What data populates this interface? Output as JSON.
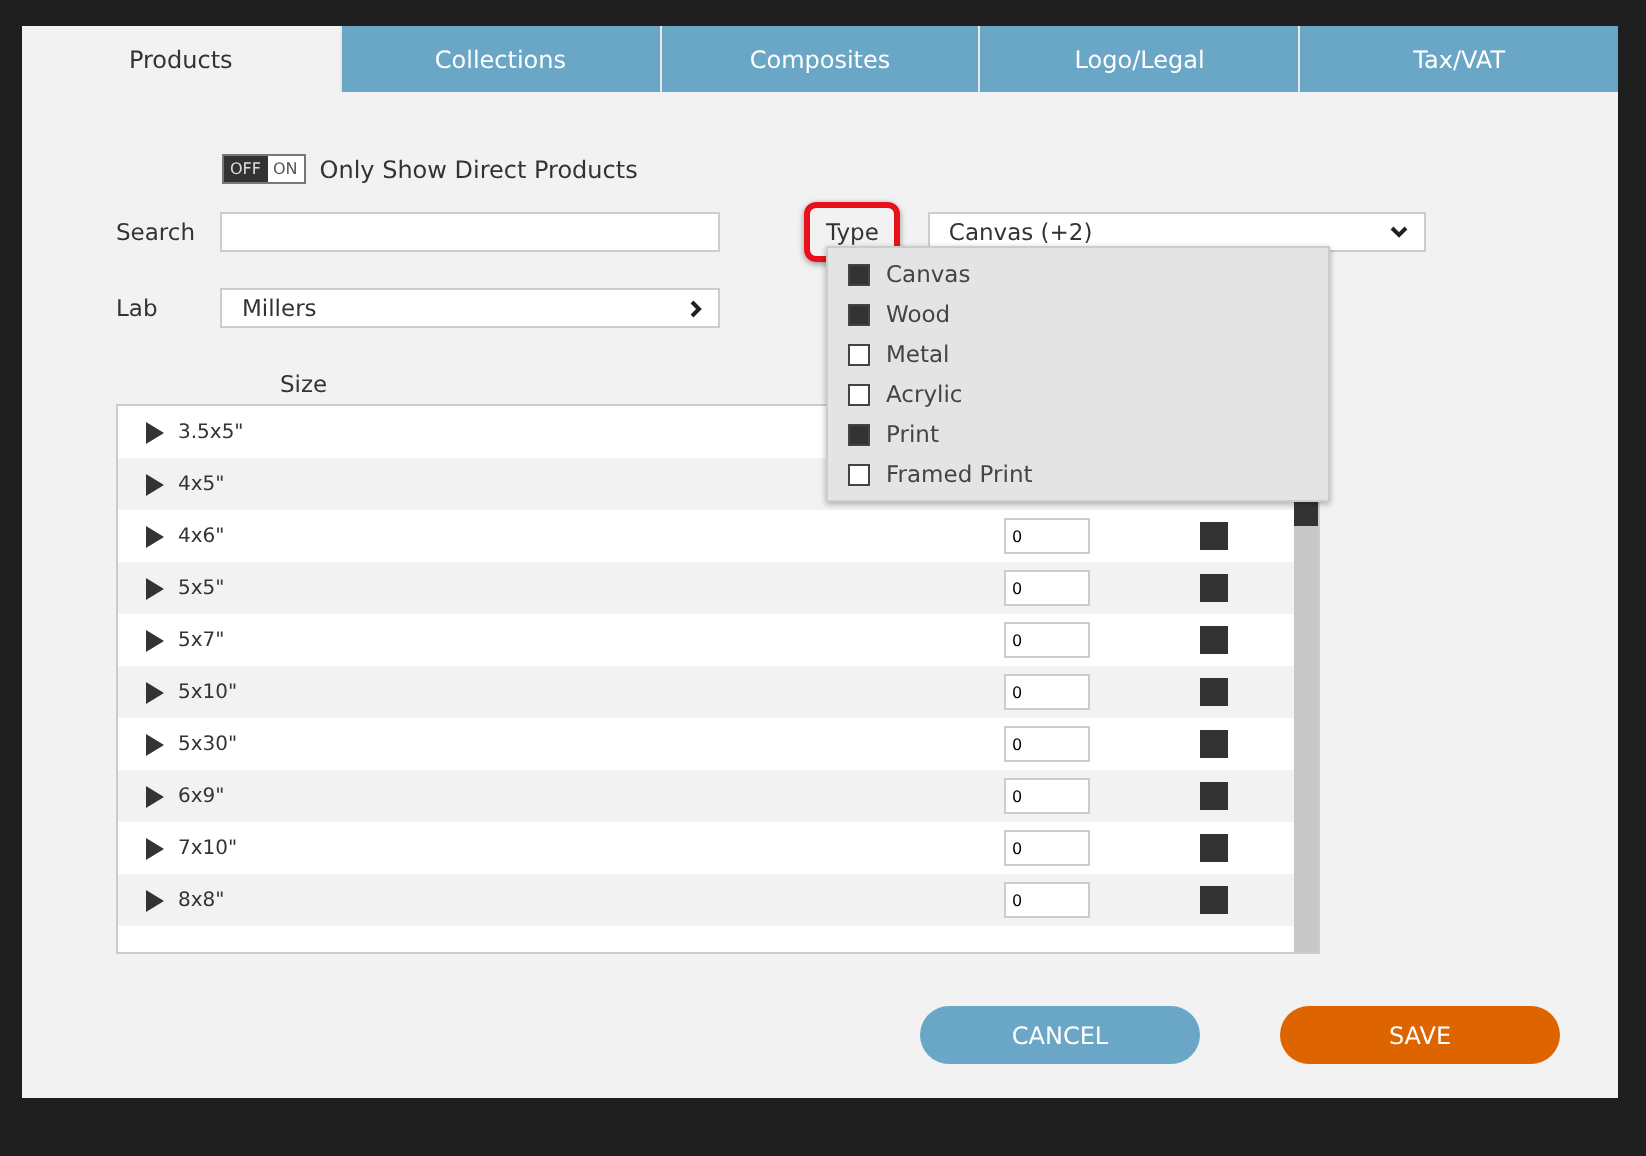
{
  "tabs": [
    {
      "label": "Products",
      "selected": true
    },
    {
      "label": "Collections",
      "selected": false
    },
    {
      "label": "Composites",
      "selected": false
    },
    {
      "label": "Logo/Legal",
      "selected": false
    },
    {
      "label": "Tax/VAT",
      "selected": false
    }
  ],
  "toggle": {
    "off_label": "OFF",
    "on_label": "ON",
    "on": false,
    "label": "Only Show Direct Products"
  },
  "search": {
    "label": "Search"
  },
  "type_filter": {
    "label": "Type",
    "highlighted": true,
    "value": "Canvas (+2)",
    "expanded": true,
    "options": [
      {
        "label": "Canvas",
        "checked": true
      },
      {
        "label": "Wood",
        "checked": true
      },
      {
        "label": "Metal",
        "checked": false
      },
      {
        "label": "Acrylic",
        "checked": false
      },
      {
        "label": "Print",
        "checked": true
      },
      {
        "label": "Framed Print",
        "checked": false
      }
    ]
  },
  "lab": {
    "label": "Lab",
    "value": "Millers"
  },
  "table": {
    "columns": [
      {
        "label": "Size"
      }
    ],
    "rows": [
      {
        "size": "3.5x5\""
      },
      {
        "size": "4x5\""
      },
      {
        "size": "4x6\"",
        "qty": "0",
        "checked": true
      },
      {
        "size": "5x5\"",
        "qty": "0",
        "checked": true
      },
      {
        "size": "5x7\"",
        "qty": "0",
        "checked": true
      },
      {
        "size": "5x10\"",
        "qty": "0",
        "checked": true
      },
      {
        "size": "5x30\"",
        "qty": "0",
        "checked": true
      },
      {
        "size": "6x9\"",
        "qty": "0",
        "checked": true
      },
      {
        "size": "7x10\"",
        "qty": "0",
        "checked": true
      },
      {
        "size": "8x8\"",
        "qty": "0",
        "checked": true
      }
    ]
  },
  "buttons": [
    {
      "label": "CANCEL",
      "kind": "secondary"
    },
    {
      "label": "SAVE",
      "kind": "primary"
    }
  ]
}
